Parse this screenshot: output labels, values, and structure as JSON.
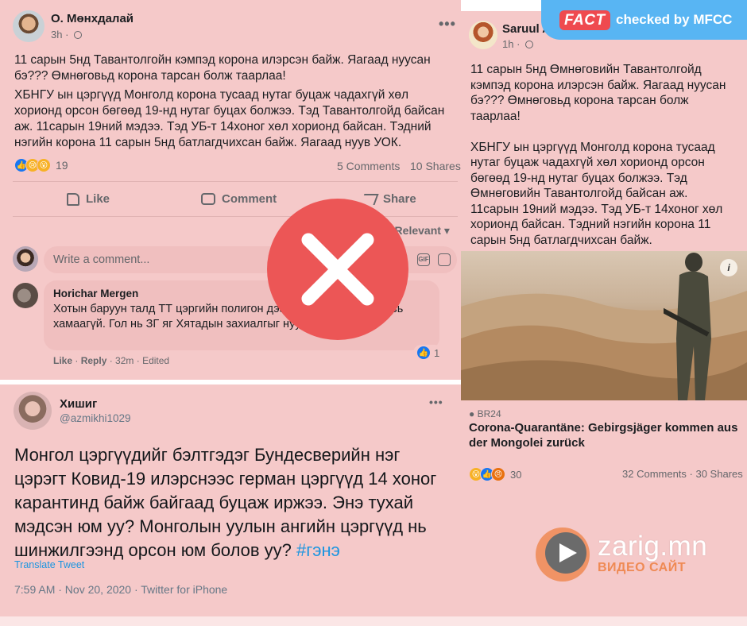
{
  "post1": {
    "author": "О. Мөнхдалай",
    "time": "3h · ",
    "paragraph1": "11 сарын 5нд Тавантолгойн кэмпэд корона илэрсэн байж. Яагаад нуусан бэ??? Өмнөговьд корона тарсан болж таарлаа!",
    "paragraph2": "ХБНГУ ын цэргүүд Монголд корона тусаад нутаг буцаж чадахгүй хөл хорионд орсон бөгөөд 19-нд нутаг буцах болжээ. Тэд Тавантолгойд байсан аж. 11сарын 19ний мэдээ. Тэд УБ-т 14хоног хөл хорионд байсан. Тэдний нэгийн корона 11 сарын 5нд батлагдчихсан байж. Яагаад нуув УОК.",
    "reaction_count": "19",
    "comments": "5 Comments",
    "shares": "10 Shares",
    "actions": {
      "like": "Like",
      "comment": "Comment",
      "share": "Share"
    },
    "sort": "Most Relevant",
    "write_placeholder": "Write a comment...",
    "comment": {
      "author": "Horichar Mergen",
      "text": "Хотын баруун талд ТТ цэргийн полигон дээр бол өглөл Өмнөговь хамаагүй. Гол нь ЗГ яг Хятадын захиалгыг нуужээ",
      "like": "Like",
      "reply": "Reply",
      "time": "32m",
      "edited": "Edited",
      "reaction_count": "1"
    }
  },
  "tweet": {
    "author": "Хишиг",
    "handle": "@azmikhi1029",
    "text": "Монгол цэргүүдийг бэлтгэдэг Бундесверийн нэг цэрэгт Ковид-19 илэрснээс герман цэргүүд 14 хоног карантинд байж байгаад буцаж иржээ. Энэ тухай мэдсэн юм уу? Монголын уулын ангийн цэргүүд нь шинжилгээнд орсон юм болов уу? ",
    "hashtag": "#гэнэ",
    "translate": "Translate Tweet",
    "timestamp": "7:59 AM · Nov 20, 2020 · Twitter for iPhone"
  },
  "post2": {
    "author": "Saruul A",
    "time": "1h · ",
    "text": "11 сарын 5нд Өмнөговийн Тавантолгойд кэмпэд корона илэрсэн байж. Яагаад нуусан бэ??? Өмнөговьд корона тарсан болж таарлаа!\n\nХБНГУ ын цэргүүд Монголд корона тусаад нутаг буцаж чадахгүй хөл хорионд орсон бөгөөд 19-нд нутаг буцах болжээ. Тэд Өмнөговийн Тавантолгойд байсан аж. 11сарын 19ний мэдээ. Тэд УБ-т 14хоног хөл хорионд байсан. Тэдний нэгийн корона 11 сарын 5нд батлагдчихсан байж.",
    "link_source": "BR24",
    "link_title": "Corona-Quarantäne: Gebirgsjäger kommen aus der Mongolei zurück",
    "reaction_count": "30",
    "stats": "32 Comments · 30 Shares"
  },
  "badge": {
    "fact": "FACT",
    "text": "checked by MFCC"
  },
  "watermark": {
    "title": "zarig.mn",
    "subtitle": "ВИДЕО САЙТ"
  },
  "icons": [
    "globe-icon",
    "like-icon",
    "comment-icon",
    "share-icon",
    "gif-icon",
    "sticker-icon",
    "info-icon",
    "x-mark-icon",
    "play-logo-icon"
  ],
  "colors": {
    "tint": "#f5c9c9",
    "facebook_blue": "#1877f2",
    "twitter_blue": "#1b95e0",
    "badge_blue": "#58b5f3",
    "fact_red": "#ef4a4f",
    "x_circle": "#ec5656",
    "logo_orange": "#ef8a54"
  }
}
